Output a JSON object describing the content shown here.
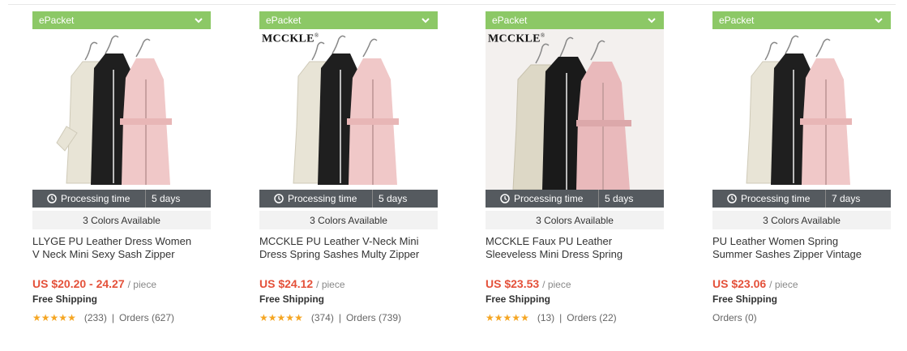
{
  "colors": {
    "shipping_bar": "#8cc866",
    "processing_bar": "#555a5f",
    "price": "#e4513a",
    "star": "#f5a623"
  },
  "products": [
    {
      "shipping": "ePacket",
      "brand": "",
      "processing_label": "Processing time",
      "processing_days": "5 days",
      "colors_available": "3 Colors Available",
      "title_line1": "LLYGE PU Leather Dress Women",
      "title_line2": "V Neck Mini Sexy Sash Zipper",
      "price": "US $20.20 - 24.27",
      "unit": "/ piece",
      "free_shipping": "Free Shipping",
      "rating": 5,
      "reviews": "(233)",
      "orders": "Orders (627)"
    },
    {
      "shipping": "ePacket",
      "brand": "MCCKLE",
      "processing_label": "Processing time",
      "processing_days": "5 days",
      "colors_available": "3 Colors Available",
      "title_line1": "MCCKLE PU Leather V-Neck Mini",
      "title_line2": "Dress Spring Sashes Multy Zipper",
      "price": "US $24.12",
      "unit": "/ piece",
      "free_shipping": "Free Shipping",
      "rating": 5,
      "reviews": "(374)",
      "orders": "Orders (739)"
    },
    {
      "shipping": "ePacket",
      "brand": "MCCKLE",
      "processing_label": "Processing time",
      "processing_days": "5 days",
      "colors_available": "3 Colors Available",
      "title_line1": "MCCKLE Faux PU Leather",
      "title_line2": "Sleeveless Mini Dress Spring",
      "price": "US $23.53",
      "unit": "/ piece",
      "free_shipping": "Free Shipping",
      "rating": 5,
      "reviews": "(13)",
      "orders": "Orders (22)"
    },
    {
      "shipping": "ePacket",
      "brand": "",
      "processing_label": "Processing time",
      "processing_days": "7 days",
      "colors_available": "3 Colors Available",
      "title_line1": "PU Leather Women Spring",
      "title_line2": "Summer Sashes Zipper Vintage",
      "price": "US $23.06",
      "unit": "/ piece",
      "free_shipping": "Free Shipping",
      "rating": null,
      "reviews": "",
      "orders": "Orders (0)"
    }
  ]
}
